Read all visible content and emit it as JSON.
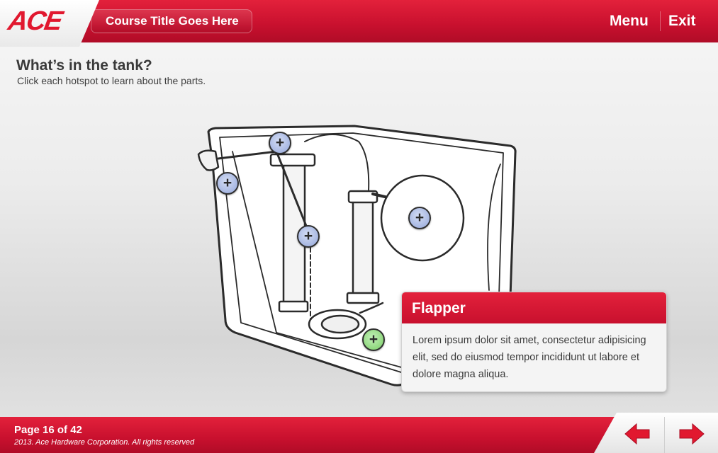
{
  "header": {
    "logo_text": "ACE",
    "course_title": "Course Title Goes Here",
    "menu_label": "Menu",
    "exit_label": "Exit"
  },
  "intro": {
    "heading": "What’s in the tank?",
    "instruction": "Click each hotspot to learn about the parts."
  },
  "hotspots": [
    {
      "label": "+",
      "state": "visited"
    },
    {
      "label": "+",
      "state": "visited"
    },
    {
      "label": "+",
      "state": "visited"
    },
    {
      "label": "+",
      "state": "visited"
    },
    {
      "label": "+",
      "state": "active"
    }
  ],
  "info_panel": {
    "title": "Flapper",
    "body": "Lorem ipsum dolor sit amet, consectetur adipisicing elit, sed do eiusmod tempor incididunt ut labore et dolore magna aliqua."
  },
  "footer": {
    "page_counter": "Page 16 of 42",
    "copyright": "2013. Ace Hardware Corporation. All rights reserved"
  },
  "colors": {
    "brand_red": "#c8102e",
    "hotspot_blue": "#a7b7e2",
    "hotspot_active_green": "#8fd87e"
  },
  "icons": {
    "prev": "left-arrow-icon",
    "next": "right-arrow-icon",
    "hotspot": "plus-icon"
  }
}
